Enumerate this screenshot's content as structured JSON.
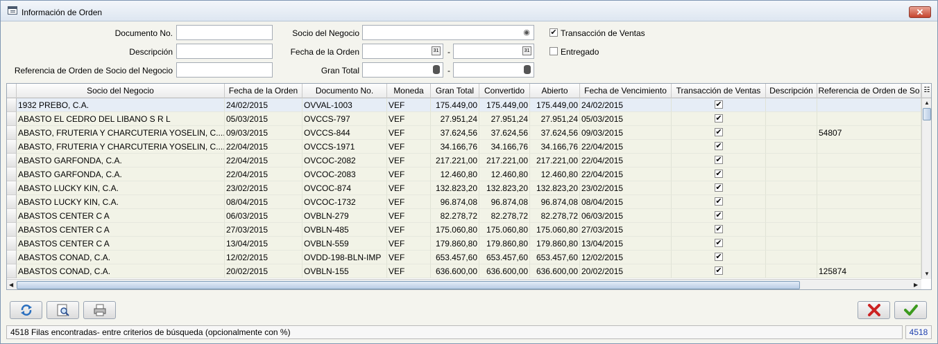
{
  "window": {
    "title": "Información de Orden",
    "close_label": "✕"
  },
  "form": {
    "documento_label": "Documento No.",
    "descripcion_label": "Descripción",
    "referencia_label": "Referencia de Orden de Socio del Negocio",
    "socio_label": "Socio del Negocio",
    "fecha_label": "Fecha de la Orden",
    "gran_total_label": "Gran Total",
    "range_separator": "-",
    "transaccion_label": "Transacción de Ventas",
    "transaccion_checked": true,
    "entregado_label": "Entregado",
    "entregado_checked": false
  },
  "grid": {
    "columns": [
      "Socio del Negocio",
      "Fecha de la Orden",
      "Documento No.",
      "Moneda",
      "Gran Total",
      "Convertido",
      "Abierto",
      "Fecha de Vencimiento",
      "Transacción de Ventas",
      "Descripción",
      "Referencia de Orden de So"
    ],
    "rows": [
      [
        "1932 PREBO,  C.A.",
        "24/02/2015",
        "OVVAL-1003",
        "VEF",
        "175.449,00",
        "175.449,00",
        "175.449,00",
        "24/02/2015",
        "✔",
        "",
        ""
      ],
      [
        "ABASTO EL CEDRO DEL LIBANO  S R L",
        "05/03/2015",
        "OVCCS-797",
        "VEF",
        "27.951,24",
        "27.951,24",
        "27.951,24",
        "05/03/2015",
        "✔",
        "",
        ""
      ],
      [
        "ABASTO, FRUTERIA Y CHARCUTERIA YOSELIN,  C....",
        "09/03/2015",
        "OVCCS-844",
        "VEF",
        "37.624,56",
        "37.624,56",
        "37.624,56",
        "09/03/2015",
        "✔",
        "",
        "54807"
      ],
      [
        "ABASTO, FRUTERIA Y CHARCUTERIA YOSELIN,  C....",
        "22/04/2015",
        "OVCCS-1971",
        "VEF",
        "34.166,76",
        "34.166,76",
        "34.166,76",
        "22/04/2015",
        "✔",
        "",
        ""
      ],
      [
        "ABASTO GARFONDA,  C.A.",
        "22/04/2015",
        "OVCOC-2082",
        "VEF",
        "217.221,00",
        "217.221,00",
        "217.221,00",
        "22/04/2015",
        "✔",
        "",
        ""
      ],
      [
        "ABASTO GARFONDA,  C.A.",
        "22/04/2015",
        "OVCOC-2083",
        "VEF",
        "12.460,80",
        "12.460,80",
        "12.460,80",
        "22/04/2015",
        "✔",
        "",
        ""
      ],
      [
        "ABASTO LUCKY KIN,  C.A.",
        "23/02/2015",
        "OVCOC-874",
        "VEF",
        "132.823,20",
        "132.823,20",
        "132.823,20",
        "23/02/2015",
        "✔",
        "",
        ""
      ],
      [
        "ABASTO LUCKY KIN,  C.A.",
        "08/04/2015",
        "OVCOC-1732",
        "VEF",
        "96.874,08",
        "96.874,08",
        "96.874,08",
        "08/04/2015",
        "✔",
        "",
        ""
      ],
      [
        "ABASTOS CENTER C A",
        "06/03/2015",
        "OVBLN-279",
        "VEF",
        "82.278,72",
        "82.278,72",
        "82.278,72",
        "06/03/2015",
        "✔",
        "",
        ""
      ],
      [
        "ABASTOS CENTER C A",
        "27/03/2015",
        "OVBLN-485",
        "VEF",
        "175.060,80",
        "175.060,80",
        "175.060,80",
        "27/03/2015",
        "✔",
        "",
        ""
      ],
      [
        "ABASTOS CENTER C A",
        "13/04/2015",
        "OVBLN-559",
        "VEF",
        "179.860,80",
        "179.860,80",
        "179.860,80",
        "13/04/2015",
        "✔",
        "",
        ""
      ],
      [
        "ABASTOS CONAD,  C.A.",
        "12/02/2015",
        "OVDD-198-BLN-IMP",
        "VEF",
        "653.457,60",
        "653.457,60",
        "653.457,60",
        "12/02/2015",
        "✔",
        "",
        ""
      ],
      [
        "ABASTOS CONAD,  C.A.",
        "20/02/2015",
        "OVBLN-155",
        "VEF",
        "636.600,00",
        "636.600,00",
        "636.600,00",
        "20/02/2015",
        "✔",
        "",
        "125874"
      ]
    ]
  },
  "toolbar": {
    "refresh_icon": "refresh-icon",
    "zoom_icon": "zoom-icon",
    "print_icon": "print-icon",
    "cancel_icon": "cancel-icon",
    "ok_icon": "ok-icon"
  },
  "status": {
    "message": "4518 Filas encontradas- entre criterios de búsqueda (opcionalmente con %)",
    "count": "4518"
  },
  "colors": {
    "row_alt": "#f2f3e7",
    "row_selected": "#e6edf6",
    "cancel_red": "#cc2222",
    "ok_green": "#3c9a1e",
    "count_blue": "#1d3fae"
  }
}
